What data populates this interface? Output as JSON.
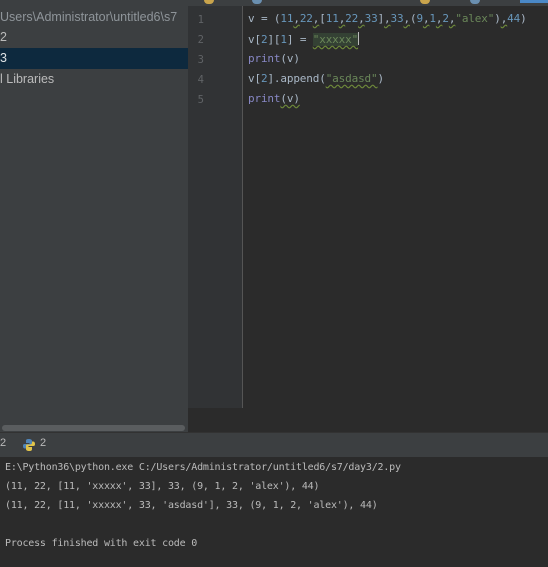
{
  "project_tree": {
    "root_path": "Users\\Administrator\\untitled6\\s7",
    "items": [
      "2",
      "3"
    ],
    "selected_item": "3",
    "external_libraries": "l Libraries"
  },
  "editor": {
    "line_numbers": [
      "1",
      "2",
      "3",
      "4",
      "5"
    ],
    "lines": {
      "l1": {
        "v": "v",
        "eq": " = (",
        "n11": "11",
        "n22": "22",
        "br_open": "[",
        "i11": "11",
        "i22": "22",
        "i33": "33",
        "br_close": "]",
        "n33": "33",
        "p_open": "(",
        "t9": "9",
        "t1": "1",
        "t2": "2",
        "alex": "\"alex\"",
        "p_close": ")",
        "n44": "44",
        "end": ")",
        "comma": ","
      },
      "l2": {
        "lhs": "v[",
        "i1": "2",
        "mid": "][",
        "i2": "1",
        "rhs": "] = ",
        "val": "\"xxxxx\""
      },
      "l3": {
        "fn": "print",
        "args": "(v)"
      },
      "l4": {
        "pre": "v[",
        "idx": "2",
        "mid": "].append(",
        "val": "\"asdasd\"",
        "end": ")"
      },
      "l5": {
        "fn": "print",
        "args": "(v)"
      }
    }
  },
  "run": {
    "tab_label": "2",
    "config_name": "2",
    "output": [
      "E:\\Python36\\python.exe C:/Users/Administrator/untitled6/s7/day3/2.py",
      "(11, 22, [11, 'xxxxx', 33], 33, (9, 1, 2, 'alex'), 44)",
      "(11, 22, [11, 'xxxxx', 33, 'asdasd'], 33, (9, 1, 2, 'alex'), 44)",
      "",
      "Process finished with exit code 0"
    ]
  },
  "colors": {
    "number": "#6897bb",
    "string": "#6a8759",
    "builtin": "#8888c6",
    "selection": "#0d293e"
  }
}
